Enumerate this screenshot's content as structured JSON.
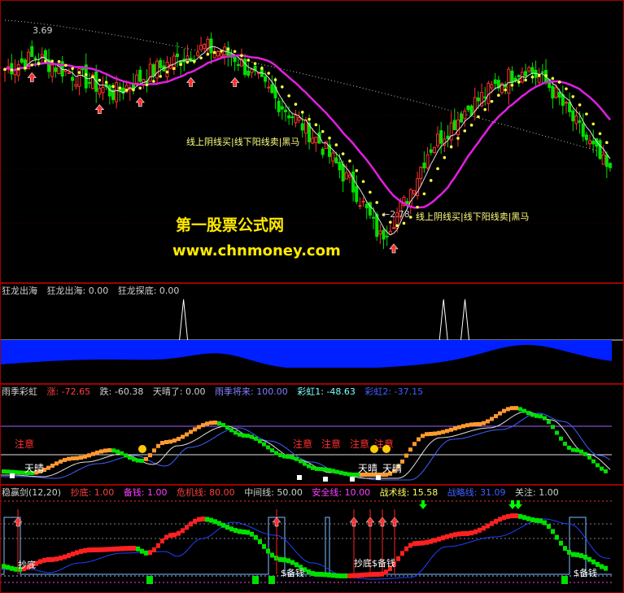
{
  "watermark": {
    "title": "第一股票公式网",
    "url": "www.chnmoney.com"
  },
  "colors": {
    "up": "#ff3030",
    "down": "#00e000",
    "border": "#a00000",
    "magenta": "#e020e0",
    "yellow": "#ffff40",
    "blue": "#0020ff",
    "orange": "#ff9a30"
  },
  "chart_data": [
    {
      "type": "candlestick",
      "name": "price-panel",
      "annotations": {
        "high_label": "3.69",
        "low_label": "←2.78",
        "text_1": "线上阴线买|线下阳线卖|黑马",
        "text_2": "线上阴线买|线下阳线卖|黑马"
      },
      "ohlc_sample": [
        {
          "i": 0,
          "o": 3.52,
          "h": 3.6,
          "l": 3.42,
          "c": 3.58
        },
        {
          "i": 10,
          "o": 3.55,
          "h": 3.69,
          "l": 3.5,
          "c": 3.62
        },
        {
          "i": 30,
          "o": 3.45,
          "h": 3.52,
          "l": 3.4,
          "c": 3.48
        },
        {
          "i": 60,
          "o": 3.6,
          "h": 3.66,
          "l": 3.55,
          "c": 3.63
        },
        {
          "i": 90,
          "o": 3.25,
          "h": 3.3,
          "l": 3.18,
          "c": 3.2
        },
        {
          "i": 110,
          "o": 2.85,
          "h": 2.95,
          "l": 2.78,
          "c": 2.9
        },
        {
          "i": 130,
          "o": 3.2,
          "h": 3.3,
          "l": 3.15,
          "c": 3.28
        },
        {
          "i": 150,
          "o": 3.45,
          "h": 3.55,
          "l": 3.4,
          "c": 3.5
        },
        {
          "i": 170,
          "o": 3.3,
          "h": 3.35,
          "l": 3.1,
          "c": 3.12
        }
      ]
    },
    {
      "type": "area",
      "name": "狂龙出海",
      "legend": {
        "name": "狂龙出海",
        "v1": "狂龙出海: 0.00",
        "v2": "狂龙探底: 0.00"
      },
      "spikes_at_fraction": [
        0.3,
        0.725,
        0.76
      ]
    },
    {
      "type": "line",
      "name": "雨季彩虹",
      "legend": {
        "name": "雨季彩虹",
        "zhang": "涨: -72.65",
        "die": "跌: -60.38",
        "tianqing": "天晴了: 0.00",
        "yuji": "雨季将来: 100.00",
        "caihong1": "彩虹1: -48.63",
        "caihong2": "彩虹2: -37.15"
      },
      "labels": {
        "zhuyi": "注意",
        "tianqing": "天晴"
      }
    },
    {
      "type": "line",
      "name": "稳赢剑",
      "legend": {
        "name": "稳赢剑(12,20)",
        "chaodi": "抄底: 1.00",
        "beiqian": "备钱: 1.00",
        "weiji": "危机线: 80.00",
        "zhongjian": "中间线: 50.00",
        "anquan": "安全线: 10.00",
        "zhanshu": "战术线: 15.58",
        "zhanlue": "战略线: 31.09",
        "guanzhu": "关注: 1.00"
      },
      "labels": {
        "chaodi": "抄底",
        "beiqian": "$备钱",
        "chaodi2": "抄底$备钱"
      }
    }
  ]
}
